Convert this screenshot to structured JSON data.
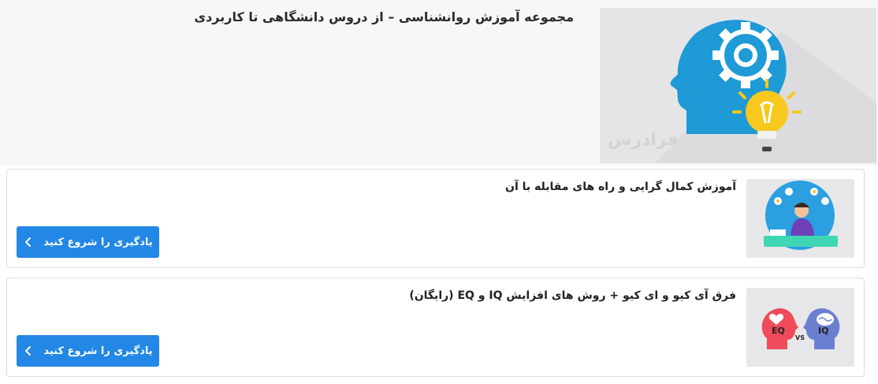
{
  "header": {
    "title": "مجموعه آموزش روانشناسی – از دروس دانشگاهی تا کاربردی",
    "hero_icon": "head-gear-lightbulb-illustration",
    "watermark": "فرادرس"
  },
  "courses": [
    {
      "title": "آموزش کمال گرایی و راه های مقابله با آن",
      "button_label": "یادگیری را شروع کنید",
      "thumbnail": "person-thinking-illustration"
    },
    {
      "title": "فرق آی کیو و ای کیو + روش های افزایش IQ و EQ (رایگان)",
      "button_label": "یادگیری را شروع کنید",
      "thumbnail": "eq-vs-iq-illustration",
      "thumb_labels": {
        "eq": "EQ",
        "vs": "VS",
        "iq": "IQ"
      }
    }
  ],
  "colors": {
    "button": "#2387e5",
    "hero_head": "#1e9ad6",
    "bulb": "#f7c81e",
    "eq_head": "#ef4b5b",
    "iq_head": "#6b7fd1"
  }
}
